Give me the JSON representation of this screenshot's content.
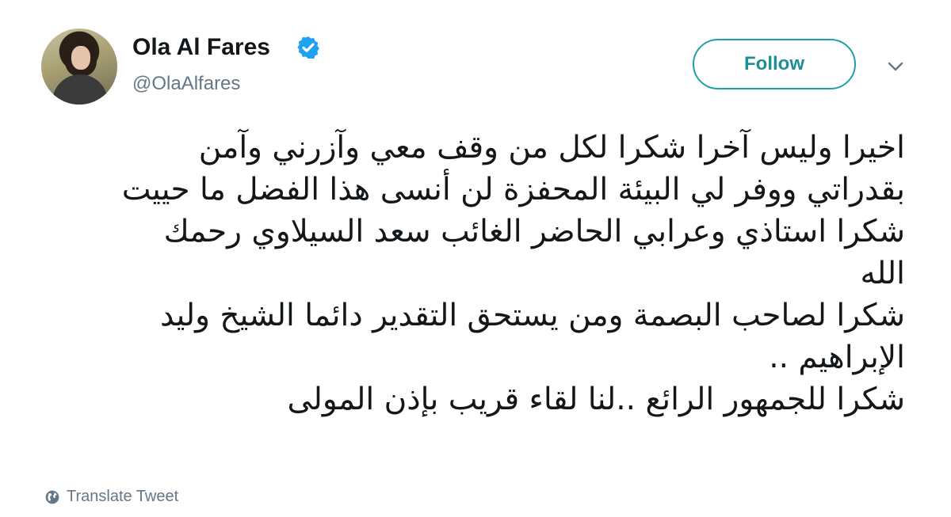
{
  "header": {
    "name": "Ola Al Fares",
    "handle": "@OlaAlfares",
    "follow_label": "Follow"
  },
  "colors": {
    "accent": "#1da1a8",
    "verified": "#1da1f2",
    "secondary_text": "#657786"
  },
  "icons": {
    "verified": "verified-badge-icon",
    "caret": "chevron-down-icon",
    "translate": "globe-icon"
  },
  "tweet": {
    "lines": [
      "اخيرا وليس آخرا  شكرا لكل من وقف معي وآزرني وآمن",
      "بقدراتي ووفر لي البيئة المحفزة لن أنسى هذا الفضل ما حييت",
      "شكرا استاذي وعرابي الحاضر الغائب سعد السيلاوي رحمك",
      "الله",
      "شكرا لصاحب البصمة ومن يستحق التقدير دائما الشيخ وليد",
      "الإبراهيم ..",
      "شكرا للجمهور الرائع ..لنا لقاء قريب بإذن المولى"
    ]
  },
  "footer": {
    "translate_label": "Translate Tweet"
  }
}
